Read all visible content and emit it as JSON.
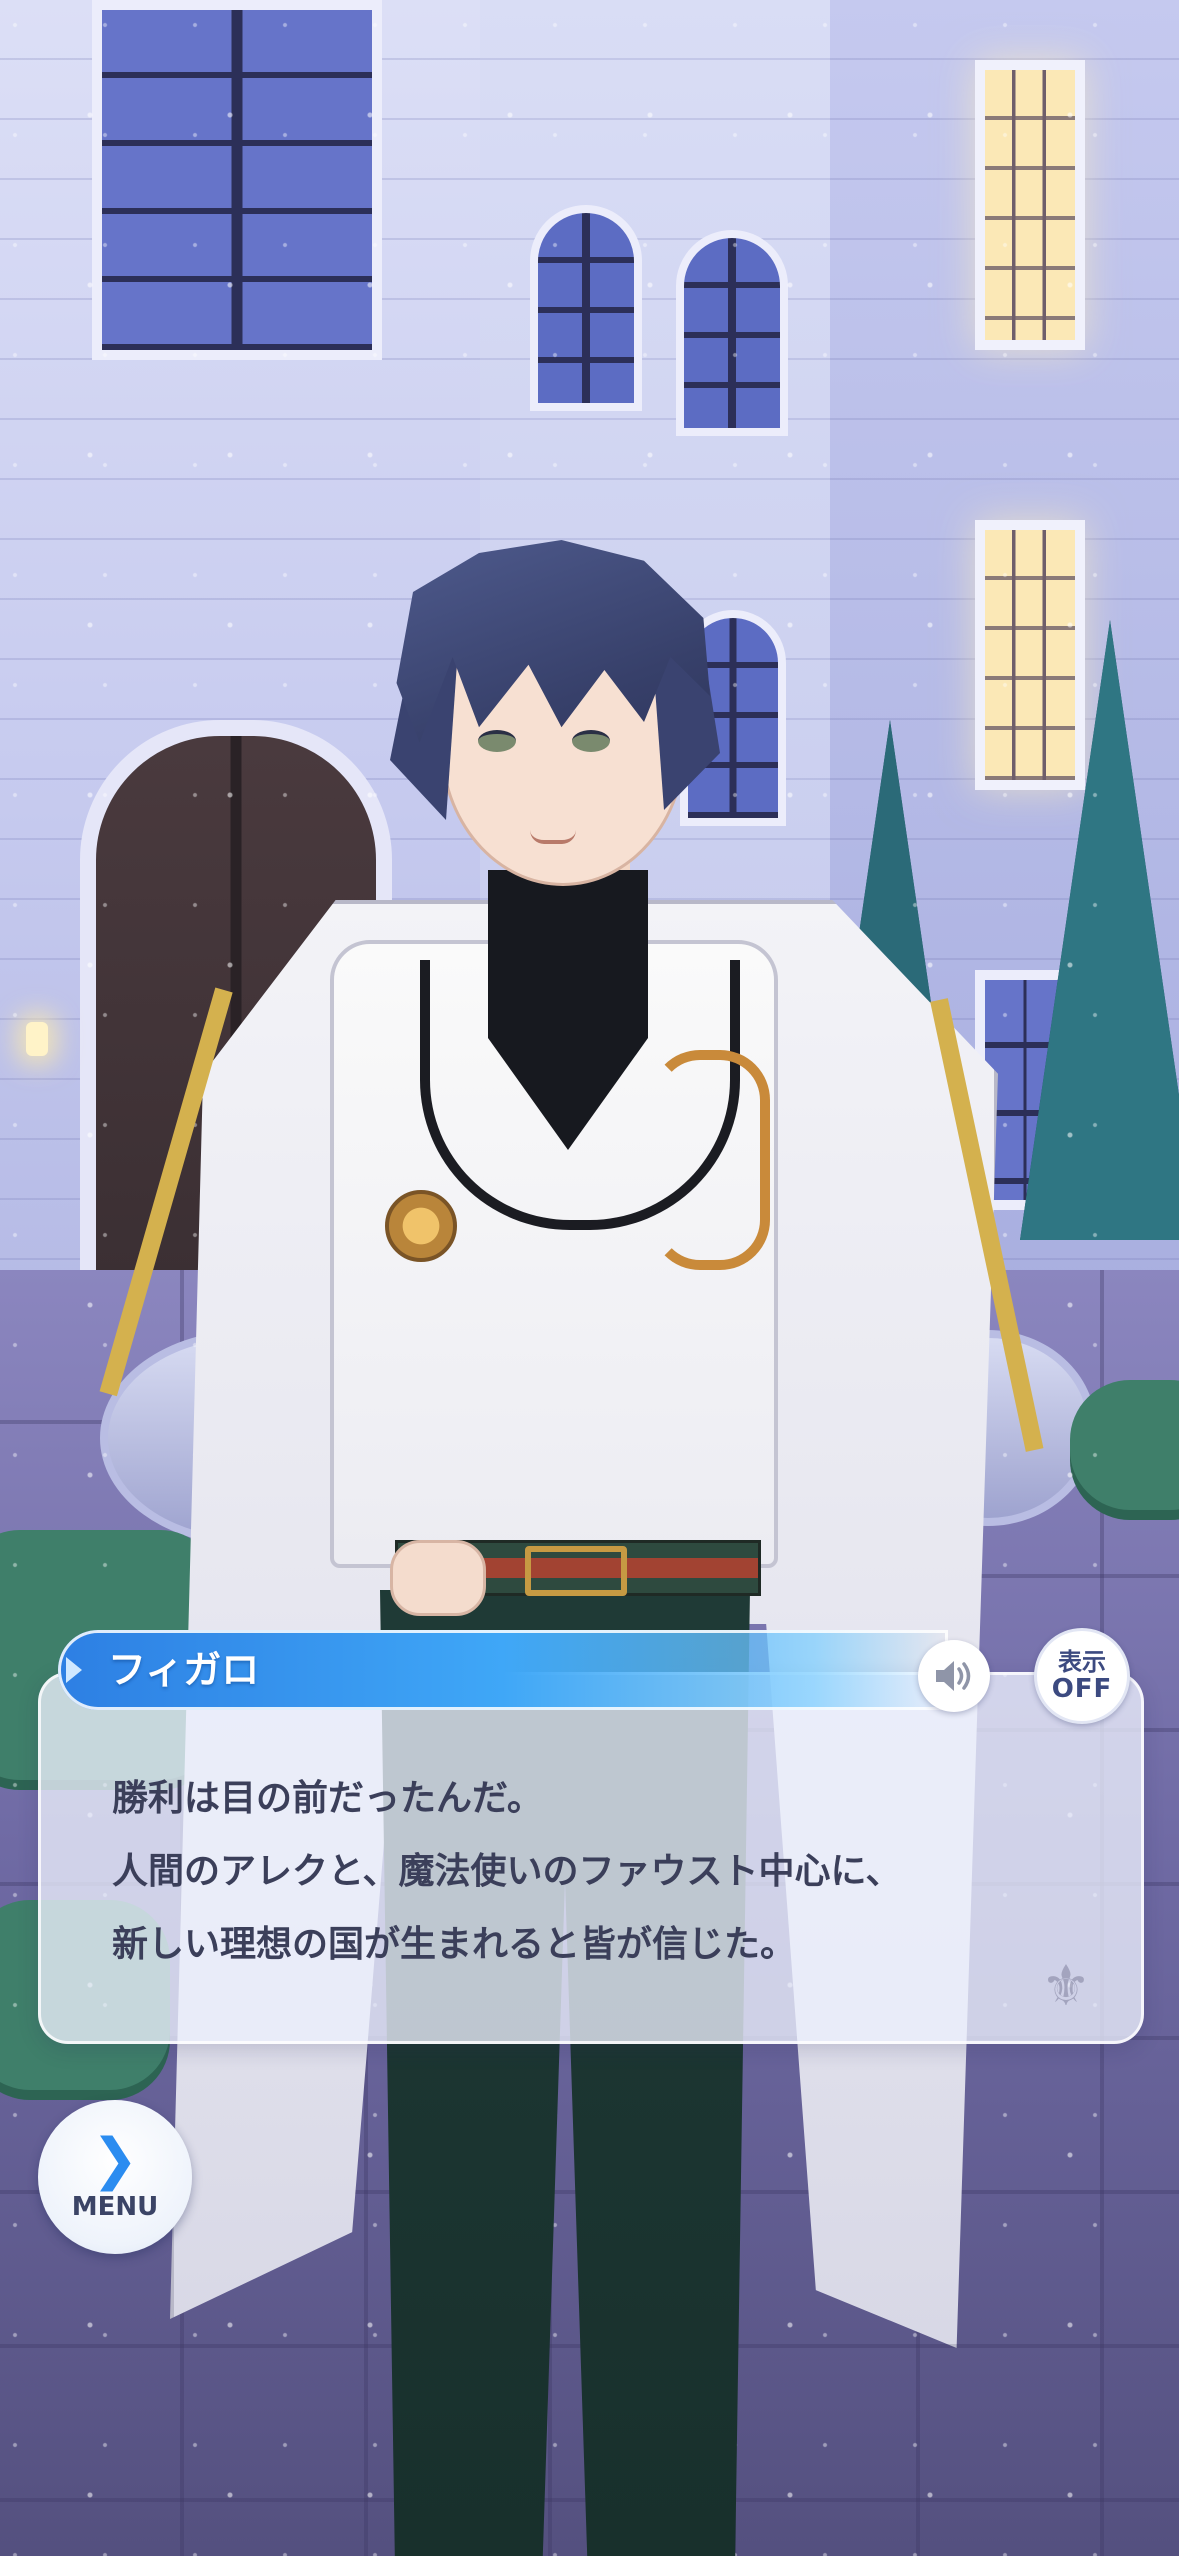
{
  "speaker": {
    "name": "フィガロ"
  },
  "dialogue": {
    "lines": [
      "勝利は目の前だったんだ。",
      "人間のアレクと、魔法使いのファウスト中心に、",
      "新しい理想の国が生まれると皆が信じた。"
    ]
  },
  "controls": {
    "voice_icon": "speaker-icon",
    "display_toggle": {
      "line1": "表示",
      "line2": "OFF"
    },
    "menu": {
      "icon": "chevron-right-icon",
      "label": "MENU"
    }
  },
  "colors": {
    "name_plate": "#3fa7f7",
    "menu_chevron": "#2b8cf0",
    "dialog_text": "#3b3f5a"
  }
}
